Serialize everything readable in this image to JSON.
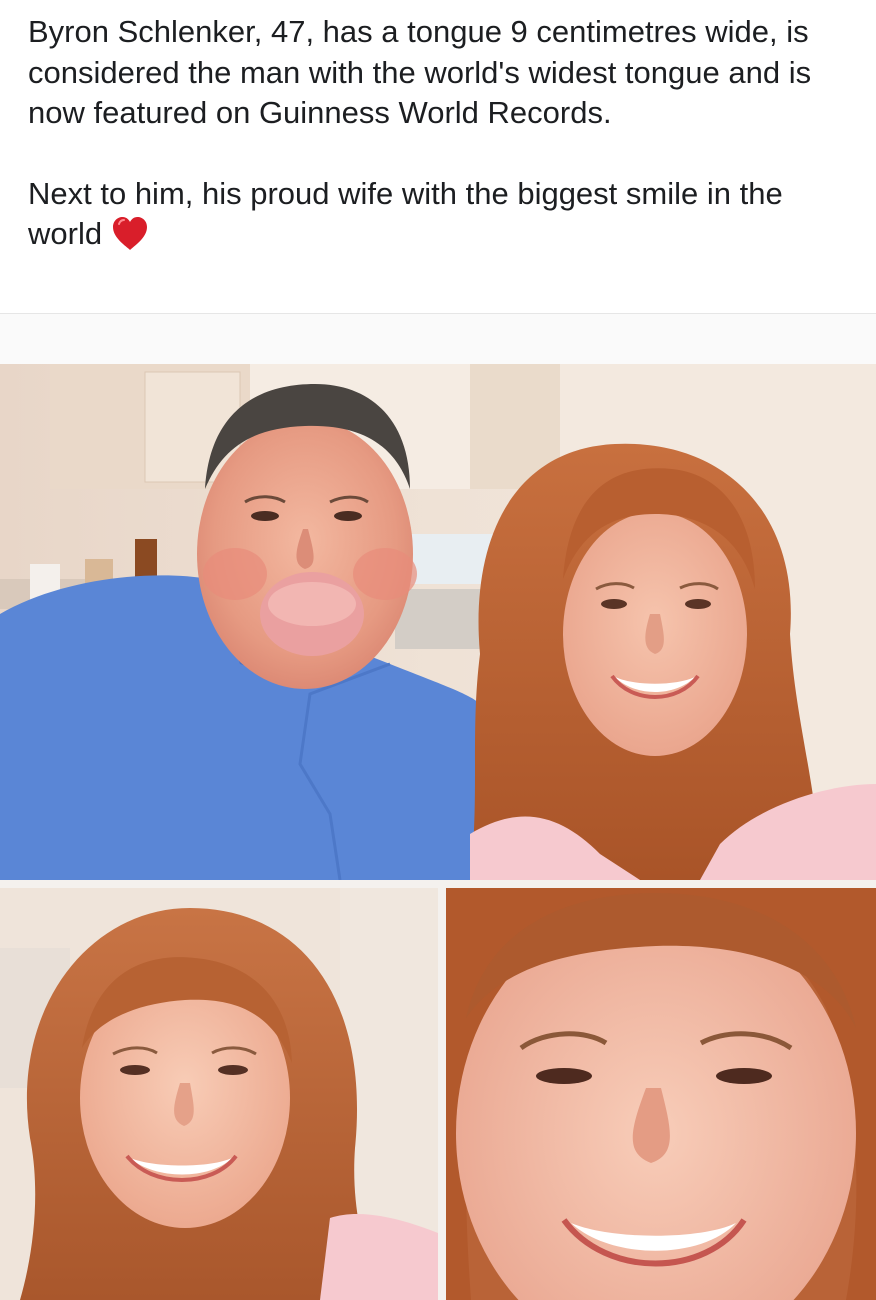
{
  "post": {
    "paragraph_1": "Byron Schlenker, 47, has a tongue 9 centimetres wide, is considered the man with the world's widest tongue and is now featured on Guinness World Records.",
    "paragraph_2": "Next to him, his proud wife with the biggest smile in the world",
    "emoji": "heart",
    "emoji_color": "#d91e2a"
  },
  "photos": [
    {
      "subject": "man-and-woman-portrait"
    },
    {
      "subject": "woman-smiling-portrait"
    },
    {
      "subject": "woman-smiling-closeup"
    }
  ]
}
